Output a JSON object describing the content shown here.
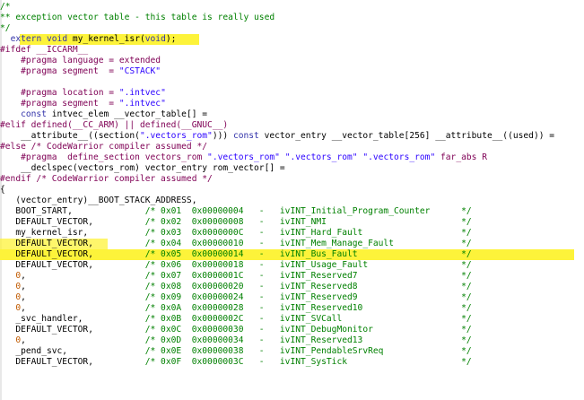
{
  "colors": {
    "comment": "#008000",
    "highlight": "#fdf33a",
    "preprocessor": "#7f0055",
    "string": "#2a00ff",
    "number": "#c05a00"
  },
  "lines": [
    "/*",
    "** exception vector table - this table is really used",
    "*/",
    "  extern void my_kernel_isr(void);",
    "#ifdef __ICCARM__",
    "    #pragma language = extended",
    "    #pragma segment  = \"CSTACK\"",
    "",
    "    #pragma location = \".intvec\"",
    "    #pragma segment  = \".intvec\"",
    "    const intvec_elem __vector_table[] =",
    "#elif defined(__CC_ARM) || defined(__GNUC__)",
    "    __attribute__((section(\".vectors_rom\"))) const vector_entry __vector_table[256] __attribute__((used)) =",
    "#else /* CodeWarrior compiler assumed */",
    "    #pragma  define_section vectors_rom \".vectors_rom\" \".vectors_rom\" \".vectors_rom\" far_abs R",
    "    __declspec(vectors_rom) vector_entry rom_vector[] =",
    "#endif /* CodeWarrior compiler assumed */",
    "{",
    "   (vector_entry)__BOOT_STACK_ADDRESS,",
    "   BOOT_START,              /* 0x01  0x00000004   -   ivINT_Initial_Program_Counter      */",
    "   DEFAULT_VECTOR,          /* 0x02  0x00000008   -   ivINT_NMI                          */",
    "   my_kernel_isr,           /* 0x03  0x0000000C   -   ivINT_Hard_Fault                   */",
    "   DEFAULT_VECTOR,          /* 0x04  0x00000010   -   ivINT_Mem_Manage_Fault             */",
    "   DEFAULT_VECTOR,          /* 0x05  0x00000014   -   ivINT_Bus_Fault                    */",
    "   DEFAULT_VECTOR,          /* 0x06  0x00000018   -   ivINT_Usage_Fault                  */",
    "   0,                       /* 0x07  0x0000001C   -   ivINT_Reserved7                    */",
    "   0,                       /* 0x08  0x00000020   -   ivINT_Reserved8                    */",
    "   0,                       /* 0x09  0x00000024   -   ivINT_Reserved9                    */",
    "   0,                       /* 0x0A  0x00000028   -   ivINT_Reserved10                   */",
    "   _svc_handler,            /* 0x0B  0x0000002C   -   ivINT_SVCall                       */",
    "   DEFAULT_VECTOR,          /* 0x0C  0x00000030   -   ivINT_DebugMonitor                 */",
    "   0,                       /* 0x0D  0x00000034   -   ivINT_Reserved13                   */",
    "   _pend_svc,               /* 0x0E  0x00000038   -   ivINT_PendableSrvReq               */",
    "   DEFAULT_VECTOR,          /* 0x0F  0x0000003C   -   ivINT_SysTick                      */"
  ]
}
